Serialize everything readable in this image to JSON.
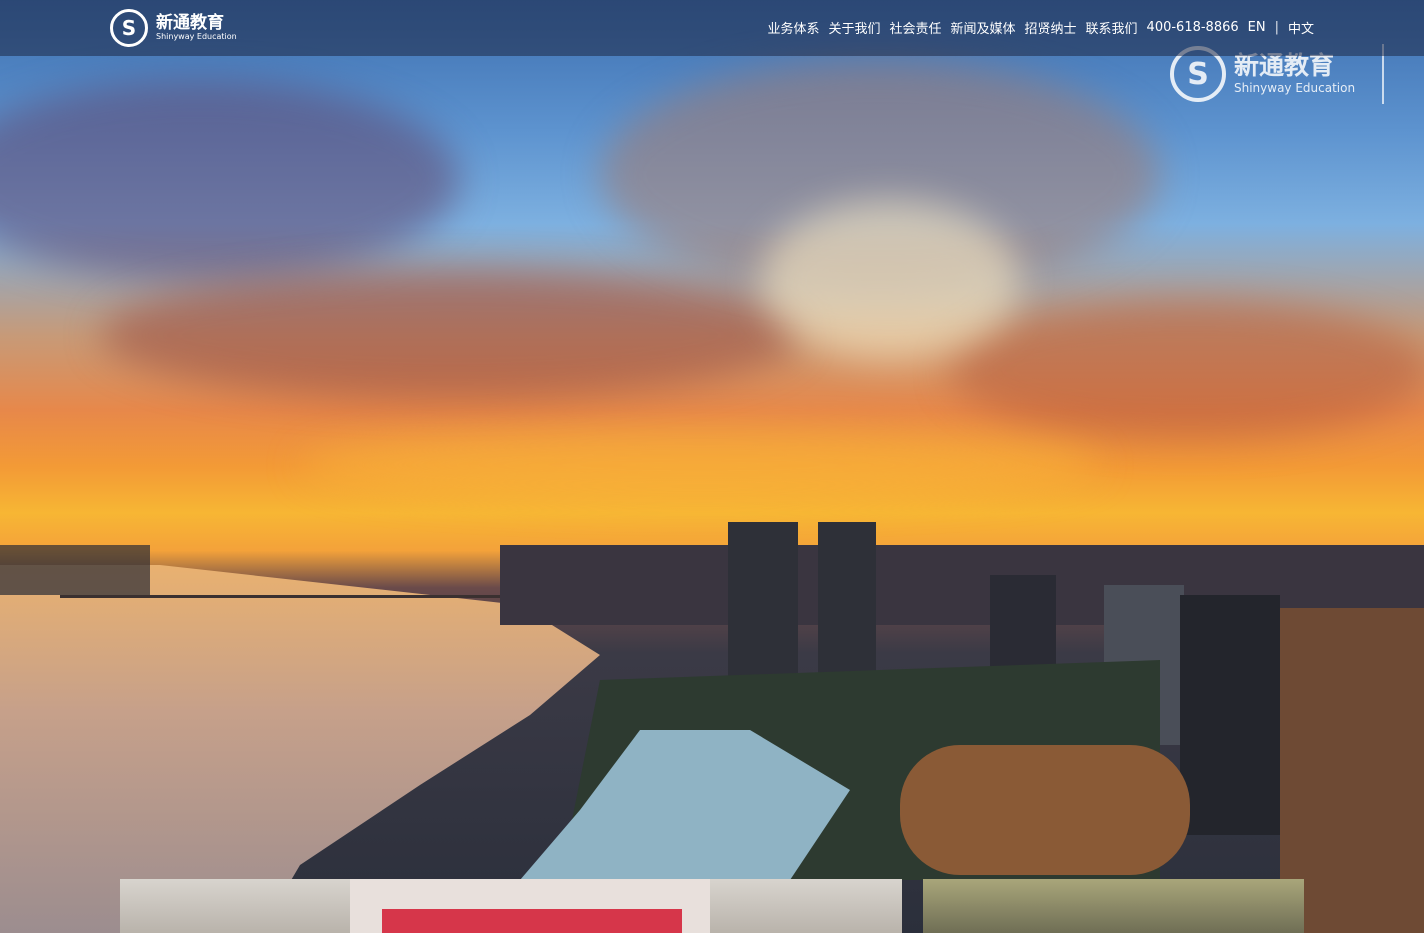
{
  "header": {
    "logo": {
      "cn": "新通教育",
      "en": "Shinyway Education"
    },
    "nav": [
      "业务体系",
      "关于我们",
      "社会责任",
      "新闻及媒体",
      "招贤纳士",
      "联系我们"
    ],
    "phone": "400-618-8866",
    "lang_en": "EN",
    "lang_sep": "|",
    "lang_cn": "中文"
  },
  "hero": {
    "watermark": {
      "cn": "新通教育",
      "en": "Shinyway Education"
    }
  },
  "colors": {
    "header_bg": "#1e2846",
    "text": "#ffffff"
  }
}
